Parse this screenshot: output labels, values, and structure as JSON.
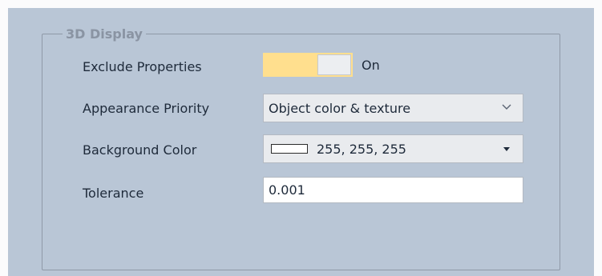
{
  "group": {
    "title": "3D Display"
  },
  "rows": {
    "exclude_properties": {
      "label": "Exclude Properties",
      "state_text": "On",
      "is_on": true
    },
    "appearance_priority": {
      "label": "Appearance Priority",
      "value": "Object color & texture"
    },
    "background_color": {
      "label": "Background Color",
      "value": "255, 255, 255",
      "swatch_color": "#ffffff"
    },
    "tolerance": {
      "label": "Tolerance",
      "value": "0.001"
    }
  },
  "icons": {
    "appearance_dropdown": "chevron-down-icon",
    "color_dropdown": "caret-down-icon"
  },
  "colors": {
    "panel_background": "#b9c6d6",
    "toggle_on": "#ffdf8e",
    "group_title": "#8a94a3"
  }
}
